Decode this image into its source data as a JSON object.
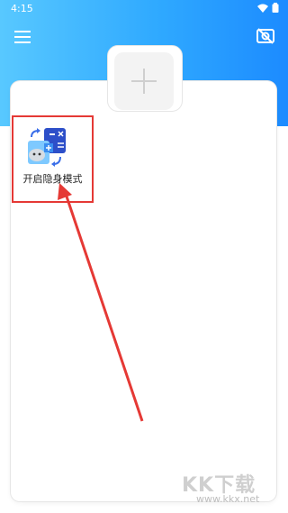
{
  "status_bar": {
    "time": "4:15"
  },
  "toolbar": {
    "menu_icon": "hamburger-menu-icon",
    "stealth_icon": "camera-off-icon"
  },
  "add_area": {
    "icon": "plus-icon"
  },
  "apps": [
    {
      "label": "开启隐身模式",
      "icon": "calculator-disguise-icon"
    }
  ],
  "annotation": {
    "highlight_color": "#e53935"
  },
  "watermark": {
    "brand": "KK下载",
    "url": "www.kkx.net"
  },
  "colors": {
    "header_start": "#58c8ff",
    "header_end": "#1c8bff"
  }
}
